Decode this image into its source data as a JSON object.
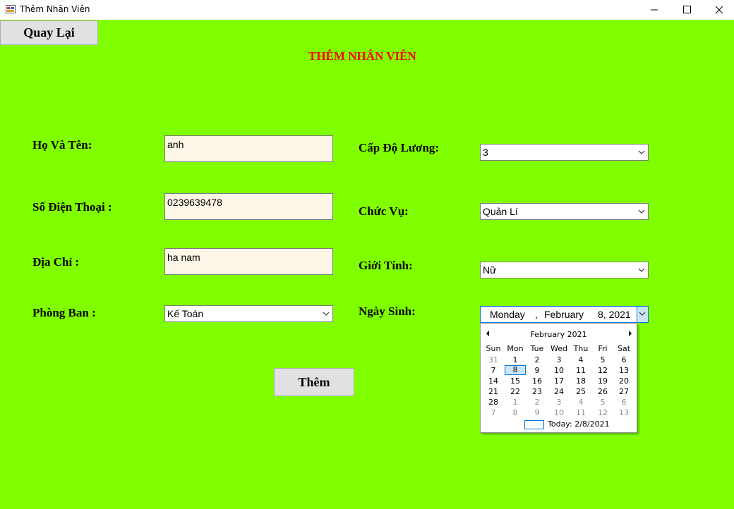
{
  "window": {
    "title": "Thêm Nhân Viên"
  },
  "header": {
    "back_label": "Quay Lại",
    "page_title": "THÊM NHÂN VIÊN"
  },
  "form": {
    "name_label": "Họ Và Tên:",
    "name_value": "anh",
    "phone_label": "Số Điện Thoại :",
    "phone_value": "0239639478",
    "address_label": "Địa Chỉ :",
    "address_value": "ha nam",
    "department_label": "Phòng Ban :",
    "department_value": "Kế Toán",
    "salary_label": "Cấp Độ Lương:",
    "salary_value": "3",
    "position_label": "Chức Vụ:",
    "position_value": "Quản Lí",
    "gender_label": "Giới Tính:",
    "gender_value": "Nữ",
    "dob_label": "Ngày Sinh:",
    "dob_weekday": "Monday",
    "dob_sep": ",",
    "dob_month": "February",
    "dob_day": "8, 2021",
    "add_label": "Thêm"
  },
  "calendar": {
    "month_label": "February 2021",
    "weekdays": [
      "Sun",
      "Mon",
      "Tue",
      "Wed",
      "Thu",
      "Fri",
      "Sat"
    ],
    "weeks": [
      [
        "31",
        "1",
        "2",
        "3",
        "4",
        "5",
        "6"
      ],
      [
        "7",
        "8",
        "9",
        "10",
        "11",
        "12",
        "13"
      ],
      [
        "14",
        "15",
        "16",
        "17",
        "18",
        "19",
        "20"
      ],
      [
        "21",
        "22",
        "23",
        "24",
        "25",
        "26",
        "27"
      ],
      [
        "28",
        "1",
        "2",
        "3",
        "4",
        "5",
        "6"
      ],
      [
        "7",
        "8",
        "9",
        "10",
        "11",
        "12",
        "13"
      ]
    ],
    "other_month": [
      [
        true,
        false,
        false,
        false,
        false,
        false,
        false
      ],
      [
        false,
        false,
        false,
        false,
        false,
        false,
        false
      ],
      [
        false,
        false,
        false,
        false,
        false,
        false,
        false
      ],
      [
        false,
        false,
        false,
        false,
        false,
        false,
        false
      ],
      [
        false,
        true,
        true,
        true,
        true,
        true,
        true
      ],
      [
        true,
        true,
        true,
        true,
        true,
        true,
        true
      ]
    ],
    "selected": "8",
    "today_label": "Today: 2/8/2021"
  },
  "colors": {
    "background": "#80ff00",
    "title": "#ff0000",
    "textbox": "#fdf5e6",
    "accent": "#0078d7"
  },
  "icons": [
    "app-icon",
    "minimize-icon",
    "maximize-icon",
    "close-icon",
    "chevron-down-icon",
    "nav-prev-icon",
    "nav-next-icon"
  ]
}
